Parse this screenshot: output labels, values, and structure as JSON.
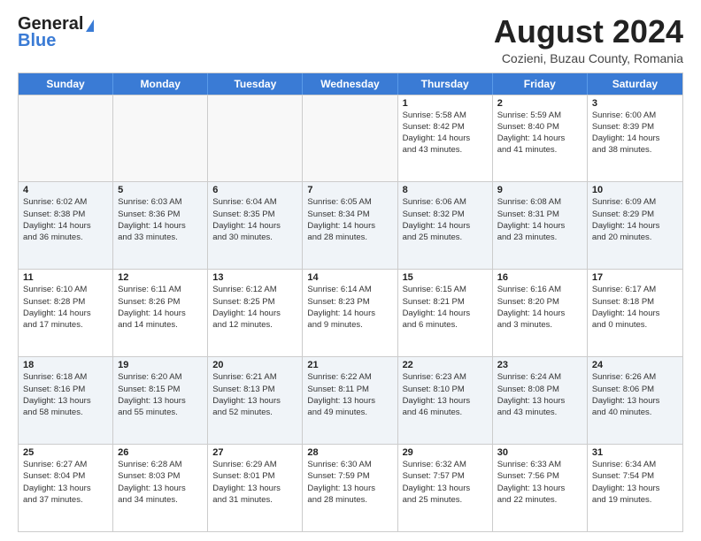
{
  "header": {
    "logo_line1": "General",
    "logo_line2": "Blue",
    "month_year": "August 2024",
    "location": "Cozieni, Buzau County, Romania"
  },
  "weekdays": [
    "Sunday",
    "Monday",
    "Tuesday",
    "Wednesday",
    "Thursday",
    "Friday",
    "Saturday"
  ],
  "rows": [
    [
      {
        "day": "",
        "info": ""
      },
      {
        "day": "",
        "info": ""
      },
      {
        "day": "",
        "info": ""
      },
      {
        "day": "",
        "info": ""
      },
      {
        "day": "1",
        "info": "Sunrise: 5:58 AM\nSunset: 8:42 PM\nDaylight: 14 hours\nand 43 minutes."
      },
      {
        "day": "2",
        "info": "Sunrise: 5:59 AM\nSunset: 8:40 PM\nDaylight: 14 hours\nand 41 minutes."
      },
      {
        "day": "3",
        "info": "Sunrise: 6:00 AM\nSunset: 8:39 PM\nDaylight: 14 hours\nand 38 minutes."
      }
    ],
    [
      {
        "day": "4",
        "info": "Sunrise: 6:02 AM\nSunset: 8:38 PM\nDaylight: 14 hours\nand 36 minutes."
      },
      {
        "day": "5",
        "info": "Sunrise: 6:03 AM\nSunset: 8:36 PM\nDaylight: 14 hours\nand 33 minutes."
      },
      {
        "day": "6",
        "info": "Sunrise: 6:04 AM\nSunset: 8:35 PM\nDaylight: 14 hours\nand 30 minutes."
      },
      {
        "day": "7",
        "info": "Sunrise: 6:05 AM\nSunset: 8:34 PM\nDaylight: 14 hours\nand 28 minutes."
      },
      {
        "day": "8",
        "info": "Sunrise: 6:06 AM\nSunset: 8:32 PM\nDaylight: 14 hours\nand 25 minutes."
      },
      {
        "day": "9",
        "info": "Sunrise: 6:08 AM\nSunset: 8:31 PM\nDaylight: 14 hours\nand 23 minutes."
      },
      {
        "day": "10",
        "info": "Sunrise: 6:09 AM\nSunset: 8:29 PM\nDaylight: 14 hours\nand 20 minutes."
      }
    ],
    [
      {
        "day": "11",
        "info": "Sunrise: 6:10 AM\nSunset: 8:28 PM\nDaylight: 14 hours\nand 17 minutes."
      },
      {
        "day": "12",
        "info": "Sunrise: 6:11 AM\nSunset: 8:26 PM\nDaylight: 14 hours\nand 14 minutes."
      },
      {
        "day": "13",
        "info": "Sunrise: 6:12 AM\nSunset: 8:25 PM\nDaylight: 14 hours\nand 12 minutes."
      },
      {
        "day": "14",
        "info": "Sunrise: 6:14 AM\nSunset: 8:23 PM\nDaylight: 14 hours\nand 9 minutes."
      },
      {
        "day": "15",
        "info": "Sunrise: 6:15 AM\nSunset: 8:21 PM\nDaylight: 14 hours\nand 6 minutes."
      },
      {
        "day": "16",
        "info": "Sunrise: 6:16 AM\nSunset: 8:20 PM\nDaylight: 14 hours\nand 3 minutes."
      },
      {
        "day": "17",
        "info": "Sunrise: 6:17 AM\nSunset: 8:18 PM\nDaylight: 14 hours\nand 0 minutes."
      }
    ],
    [
      {
        "day": "18",
        "info": "Sunrise: 6:18 AM\nSunset: 8:16 PM\nDaylight: 13 hours\nand 58 minutes."
      },
      {
        "day": "19",
        "info": "Sunrise: 6:20 AM\nSunset: 8:15 PM\nDaylight: 13 hours\nand 55 minutes."
      },
      {
        "day": "20",
        "info": "Sunrise: 6:21 AM\nSunset: 8:13 PM\nDaylight: 13 hours\nand 52 minutes."
      },
      {
        "day": "21",
        "info": "Sunrise: 6:22 AM\nSunset: 8:11 PM\nDaylight: 13 hours\nand 49 minutes."
      },
      {
        "day": "22",
        "info": "Sunrise: 6:23 AM\nSunset: 8:10 PM\nDaylight: 13 hours\nand 46 minutes."
      },
      {
        "day": "23",
        "info": "Sunrise: 6:24 AM\nSunset: 8:08 PM\nDaylight: 13 hours\nand 43 minutes."
      },
      {
        "day": "24",
        "info": "Sunrise: 6:26 AM\nSunset: 8:06 PM\nDaylight: 13 hours\nand 40 minutes."
      }
    ],
    [
      {
        "day": "25",
        "info": "Sunrise: 6:27 AM\nSunset: 8:04 PM\nDaylight: 13 hours\nand 37 minutes."
      },
      {
        "day": "26",
        "info": "Sunrise: 6:28 AM\nSunset: 8:03 PM\nDaylight: 13 hours\nand 34 minutes."
      },
      {
        "day": "27",
        "info": "Sunrise: 6:29 AM\nSunset: 8:01 PM\nDaylight: 13 hours\nand 31 minutes."
      },
      {
        "day": "28",
        "info": "Sunrise: 6:30 AM\nSunset: 7:59 PM\nDaylight: 13 hours\nand 28 minutes."
      },
      {
        "day": "29",
        "info": "Sunrise: 6:32 AM\nSunset: 7:57 PM\nDaylight: 13 hours\nand 25 minutes."
      },
      {
        "day": "30",
        "info": "Sunrise: 6:33 AM\nSunset: 7:56 PM\nDaylight: 13 hours\nand 22 minutes."
      },
      {
        "day": "31",
        "info": "Sunrise: 6:34 AM\nSunset: 7:54 PM\nDaylight: 13 hours\nand 19 minutes."
      }
    ]
  ]
}
